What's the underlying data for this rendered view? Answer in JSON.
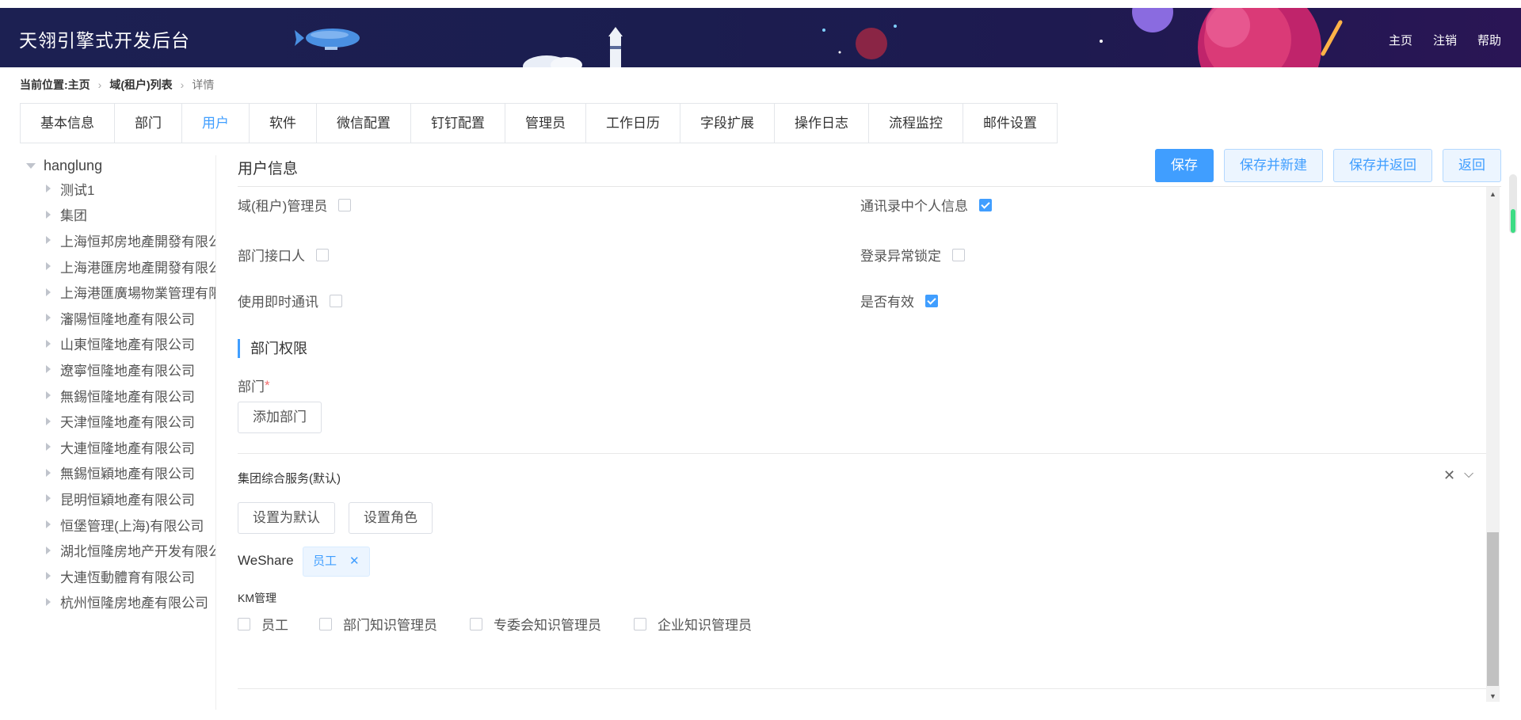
{
  "header": {
    "app_title": "天翎引擎式开发后台",
    "nav": [
      "主页",
      "注销",
      "帮助"
    ]
  },
  "breadcrumb": {
    "prefix": "当前位置:",
    "items": [
      "主页",
      "域(租户)列表"
    ],
    "current": "详情"
  },
  "tabs": [
    {
      "label": "基本信息"
    },
    {
      "label": "部门"
    },
    {
      "label": "用户",
      "active": true
    },
    {
      "label": "软件"
    },
    {
      "label": "微信配置"
    },
    {
      "label": "钉钉配置"
    },
    {
      "label": "管理员"
    },
    {
      "label": "工作日历"
    },
    {
      "label": "字段扩展"
    },
    {
      "label": "操作日志"
    },
    {
      "label": "流程监控"
    },
    {
      "label": "邮件设置"
    }
  ],
  "tree": {
    "root": "hanglung",
    "children": [
      "测试1",
      "集团",
      "上海恒邦房地產開發有限公",
      "上海港匯房地產開發有限公",
      "上海港匯廣場物業管理有限",
      "瀋陽恒隆地產有限公司",
      "山東恒隆地產有限公司",
      "遼寧恒隆地產有限公司",
      "無錫恒隆地產有限公司",
      "天津恒隆地產有限公司",
      "大連恒隆地產有限公司",
      "無錫恒穎地產有限公司",
      "昆明恒穎地產有限公司",
      "恒堡管理(上海)有限公司",
      "湖北恒隆房地产开发有限公",
      "大連恆動體育有限公司",
      "杭州恒隆房地產有限公司"
    ]
  },
  "panel": {
    "title": "用户信息",
    "buttons": {
      "save": "保存",
      "save_new": "保存并新建",
      "save_return": "保存并返回",
      "back": "返回"
    }
  },
  "fields": {
    "tenant_admin": {
      "label": "域(租户)管理员",
      "checked": false
    },
    "contact_info": {
      "label": "通讯录中个人信息",
      "checked": true
    },
    "dept_contact": {
      "label": "部门接口人",
      "checked": false
    },
    "login_lock": {
      "label": "登录异常锁定",
      "checked": false
    },
    "im": {
      "label": "使用即时通讯",
      "checked": false
    },
    "valid": {
      "label": "是否有效",
      "checked": true
    }
  },
  "dept_perm": {
    "section_title": "部门权限",
    "dept_label": "部门",
    "required_mark": "*",
    "add_dept": "添加部门"
  },
  "dept_entry": {
    "title": "集团综合服务(默认)",
    "set_default": "设置为默认",
    "set_role": "设置角色",
    "weshare_label": "WeShare",
    "weshare_tag": "员工",
    "km_label": "KM管理",
    "km_roles": [
      "员工",
      "部门知识管理员",
      "专委会知识管理员",
      "企业知识管理员"
    ]
  },
  "colors": {
    "accent": "#409eff",
    "header_bg": "#1c2052"
  }
}
